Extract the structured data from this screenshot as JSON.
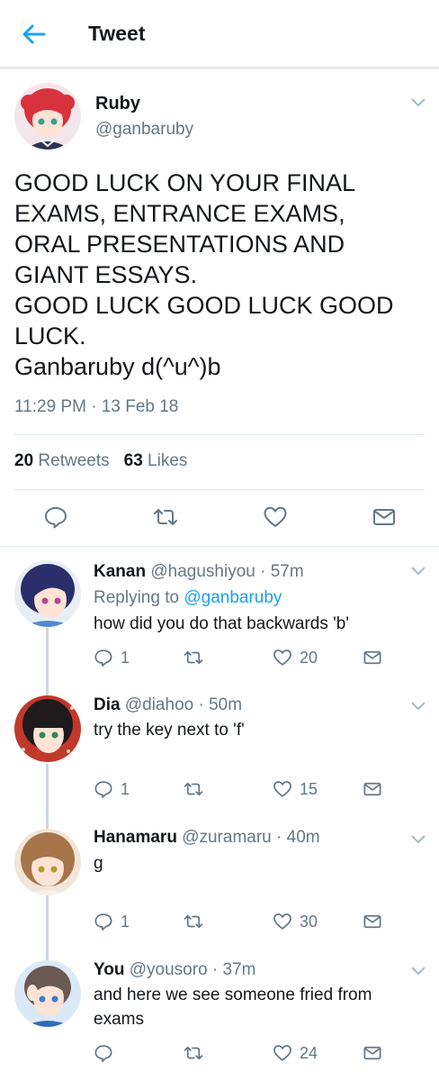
{
  "header": {
    "title": "Tweet"
  },
  "colors": {
    "accent": "#1da1f2",
    "secondary_text": "#657786",
    "divider": "#e1e8ed",
    "thread_line": "#ccd6dd"
  },
  "main_tweet": {
    "name": "Ruby",
    "handle": "@ganbaruby",
    "text": "GOOD LUCK ON YOUR FINAL\nEXAMS, ENTRANCE EXAMS,\nORAL PRESENTATIONS AND\nGIANT ESSAYS.\nGOOD LUCK GOOD LUCK GOOD\nLUCK.\nGanbaruby d(^u^)b",
    "timestamp": "11:29 PM · 13 Feb 18",
    "retweets_count": "20",
    "retweets_label": "Retweets",
    "likes_count": "63",
    "likes_label": "Likes"
  },
  "replies": [
    {
      "name": "Kanan",
      "meta": "@hagushiyou · 57m",
      "replying_prefix": "Replying to",
      "replying_to": "@ganbaruby",
      "text": "how did you do that backwards 'b'",
      "reply_count": "1",
      "like_count": "20"
    },
    {
      "name": "Dia",
      "meta": "@diahoo · 50m",
      "text": "try the key next to 'f'",
      "reply_count": "1",
      "like_count": "15"
    },
    {
      "name": "Hanamaru",
      "meta": "@zuramaru · 40m",
      "text": "g",
      "reply_count": "1",
      "like_count": "30"
    },
    {
      "name": "You",
      "meta": "@yousoro · 37m",
      "text": "and here we see someone fried from exams",
      "reply_count": "",
      "like_count": "24"
    }
  ]
}
